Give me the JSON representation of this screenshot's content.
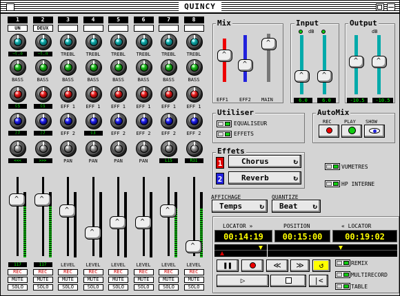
{
  "window": {
    "title": "QUINCY"
  },
  "channels": [
    {
      "num": "1",
      "name": "UN",
      "top_val": "+5.0",
      "red_val": "95",
      "blue_val": "37",
      "pan_val": "<<<",
      "eff2_label": "EFF 2",
      "eff1_label": "EFF 1",
      "gray_label": "",
      "bottom_val": "117",
      "fader": 0.78,
      "vu": 0.78
    },
    {
      "num": "2",
      "name": "DEUX",
      "top_val": "+5.0",
      "red_val": "95",
      "blue_val": "37",
      "pan_val": ">>>",
      "eff2_label": "EFF 2",
      "eff1_label": "EFF 1",
      "gray_label": "",
      "bottom_val": "117",
      "fader": 0.78,
      "vu": 0.78
    },
    {
      "num": "3",
      "name": "",
      "top_val": "",
      "red_val": "",
      "blue_val": "",
      "pan_val": "",
      "eff2_label": "EFF 2",
      "eff1_label": "EFF 1",
      "gray_label": "PAN",
      "bottom_val": "",
      "fader": 0.62,
      "vu": 0
    },
    {
      "num": "4",
      "name": "",
      "top_val": "",
      "red_val": "",
      "blue_val": "93",
      "pan_val": "",
      "eff2_label": "EFF 2",
      "eff1_label": "EFF 1",
      "gray_label": "PAN",
      "bottom_val": "",
      "fader": 0.3,
      "vu": 0
    },
    {
      "num": "5",
      "name": "",
      "top_val": "",
      "red_val": "",
      "blue_val": "",
      "pan_val": "",
      "eff2_label": "EFF 2",
      "eff1_label": "EFF 1",
      "gray_label": "PAN",
      "bottom_val": "",
      "fader": 0.45,
      "vu": 0
    },
    {
      "num": "6",
      "name": "",
      "top_val": "",
      "red_val": "",
      "blue_val": "",
      "pan_val": "",
      "eff2_label": "EFF 2",
      "eff1_label": "EFF 1",
      "gray_label": "PAN",
      "bottom_val": "",
      "fader": 0.45,
      "vu": 0
    },
    {
      "num": "7",
      "name": "",
      "top_val": "",
      "red_val": "",
      "blue_val": "",
      "pan_val": "L15",
      "eff2_label": "EFF 2",
      "eff1_label": "EFF 1",
      "gray_label": "",
      "bottom_val": "",
      "fader": 0.62,
      "vu": 0.75
    },
    {
      "num": "8",
      "name": "",
      "top_val": "",
      "red_val": "",
      "blue_val": "",
      "pan_val": "R31",
      "eff2_label": "EFF 2",
      "eff1_label": "EFF 1",
      "gray_label": "",
      "bottom_val": "",
      "fader": 0.1,
      "vu": 0.75
    }
  ],
  "strip_labels": {
    "treble": "TREBL",
    "bass": "BASS",
    "level": "LEVEL",
    "rec": "REC",
    "mute": "MUTE",
    "solo": "SOLO"
  },
  "mix": {
    "title": "Mix",
    "labels": [
      "EFF1",
      "EFF2",
      "MAIN"
    ]
  },
  "input": {
    "title": "Input",
    "db": "dB",
    "values": [
      "6.0",
      "6.0"
    ]
  },
  "output": {
    "title": "Output",
    "db": "dB",
    "values": [
      "-10.5",
      "-10.5"
    ]
  },
  "utiliser": {
    "title": "Utiliser",
    "items": [
      "EQUALISEUR",
      "EFFETS"
    ]
  },
  "automix": {
    "title": "AutoMix",
    "labels": [
      "REC",
      "PLAY",
      "SHOW"
    ]
  },
  "effets": {
    "title": "Effets",
    "slots": [
      {
        "num": "1",
        "name": "Chorus"
      },
      {
        "num": "2",
        "name": "Reverb"
      }
    ]
  },
  "options_right": [
    "VUMETRES",
    "HP INTERNE"
  ],
  "affichage": {
    "label": "AFFICHAGE",
    "value": "Temps"
  },
  "quantize": {
    "label": "QUANTIZE",
    "value": "Beat"
  },
  "transport": {
    "locator_left_label": "LOCATOR »",
    "position_label": "POSITION",
    "locator_right_label": "« LOCATOR",
    "locator_left": "00:14:19",
    "position": "00:15:00",
    "locator_right": "00:19:02",
    "timeline_position": 0.4
  },
  "options_bottom": [
    "REMIX",
    "MULTIRECORD",
    "TABLE"
  ],
  "colors": {
    "window_bg": "#d4d4d4",
    "led_green": "#11bb11",
    "red": "#dd0000",
    "blue": "#2222dd",
    "teal": "#00aaaa"
  }
}
